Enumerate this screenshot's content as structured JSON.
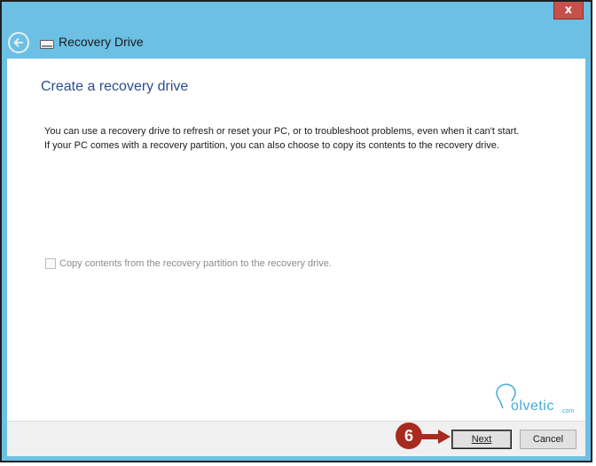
{
  "window": {
    "title": "Recovery Drive",
    "close_label": "x",
    "back_icon": "back-arrow-icon",
    "drive_icon": "drive-icon"
  },
  "page": {
    "heading": "Create a recovery drive",
    "description": "You can use a recovery drive to refresh or reset your PC, or to troubleshoot problems, even when it can't start. If your PC comes with a recovery partition, you can also choose to copy its contents to the recovery drive.",
    "checkbox": {
      "label": "Copy contents from the recovery partition to the recovery drive.",
      "checked": false,
      "enabled": false
    }
  },
  "footer": {
    "next_label": "Next",
    "cancel_label": "Cancel"
  },
  "annotation": {
    "step_number": "6",
    "color": "#a8291e"
  },
  "watermark": {
    "text": "olvetic",
    "suffix": ".com"
  },
  "colors": {
    "title_bar": "#6cc0e4",
    "close_button": "#c7504a",
    "heading": "#2a4d8f"
  }
}
